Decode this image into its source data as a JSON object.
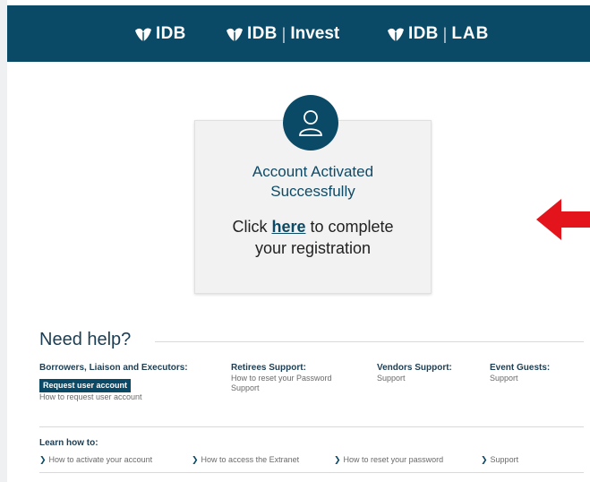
{
  "header": {
    "logos": [
      {
        "brand": "IDB",
        "sub": ""
      },
      {
        "brand": "IDB",
        "sub": "Invest"
      },
      {
        "brand": "IDB",
        "sub": "LAB"
      }
    ]
  },
  "card": {
    "title_line1": "Account Activated",
    "title_line2": "Successfully",
    "cta_prefix": "Click ",
    "cta_link": "here",
    "cta_suffix_line1": " to complete",
    "cta_line2": "your registration"
  },
  "help": {
    "title": "Need help?",
    "columns": [
      {
        "heading": "Borrowers, Liaison and Executors:",
        "button": "Request user account",
        "text": "How to request user account"
      },
      {
        "heading": "Retirees Support:",
        "text_line1": "How to reset your Password",
        "text_line2": "Support"
      },
      {
        "heading": "Vendors Support:",
        "text": "Support"
      },
      {
        "heading": "Event Guests:",
        "text": "Support"
      }
    ]
  },
  "learn": {
    "heading": "Learn how to:",
    "links": [
      "How to activate your account",
      "How to access the Extranet",
      "How to reset your password",
      "Support"
    ]
  },
  "colors": {
    "brand": "#0b4a66",
    "arrow": "#e3141b",
    "card_bg": "#f2f2f2"
  }
}
